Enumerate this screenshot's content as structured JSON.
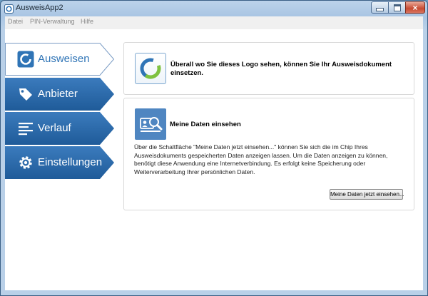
{
  "window": {
    "title": "AusweisApp2"
  },
  "menu": [
    "Datei",
    "PIN-Verwaltung",
    "Hilfe"
  ],
  "nav": [
    {
      "label": "Ausweisen",
      "icon": "ausweisen-logo-icon",
      "active": true
    },
    {
      "label": "Anbieter",
      "icon": "tag-icon",
      "active": false
    },
    {
      "label": "Verlauf",
      "icon": "list-icon",
      "active": false
    },
    {
      "label": "Einstellungen",
      "icon": "gear-icon",
      "active": false
    }
  ],
  "info_card": {
    "text": "Überall wo Sie dieses Logo sehen, können Sie Ihr Ausweisdokument einsetzen."
  },
  "feature_card": {
    "title": "Meine Daten einsehen",
    "description": "Über die Schaltfläche \"Meine Daten jetzt einsehen...\" können Sie sich die im Chip Ihres Ausweisdokuments gespeicherten Daten anzeigen lassen. Um die Daten anzeigen zu können, benötigt diese Anwendung eine Internetverbindung. Es erfolgt keine Speicherung oder Weiterverarbeitung Ihrer persönlichen Daten.",
    "button": "Meine Daten jetzt einsehen..."
  },
  "colors": {
    "nav_blue": "#2a69a9",
    "active_text": "#2f74b6",
    "accent_green": "#7fc241"
  }
}
